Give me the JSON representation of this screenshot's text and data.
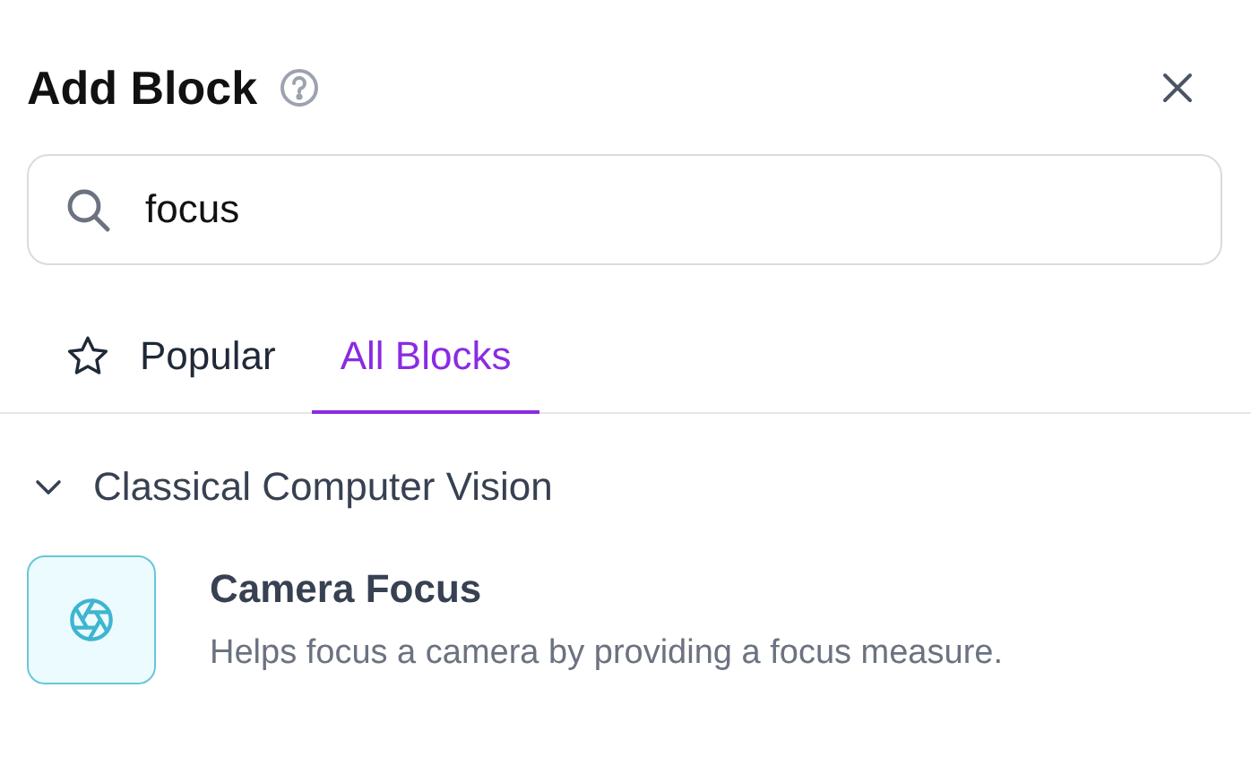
{
  "dialog": {
    "title": "Add Block"
  },
  "search": {
    "value": "focus"
  },
  "tabs": [
    {
      "label": "Popular",
      "kind": "starred",
      "selected": false
    },
    {
      "label": "All Blocks",
      "kind": "plain",
      "selected": true
    }
  ],
  "sections": [
    {
      "title": "Classical Computer Vision",
      "expanded": true,
      "blocks": [
        {
          "name": "Camera Focus",
          "description": "Helps focus a camera by providing a focus measure."
        }
      ]
    }
  ]
}
